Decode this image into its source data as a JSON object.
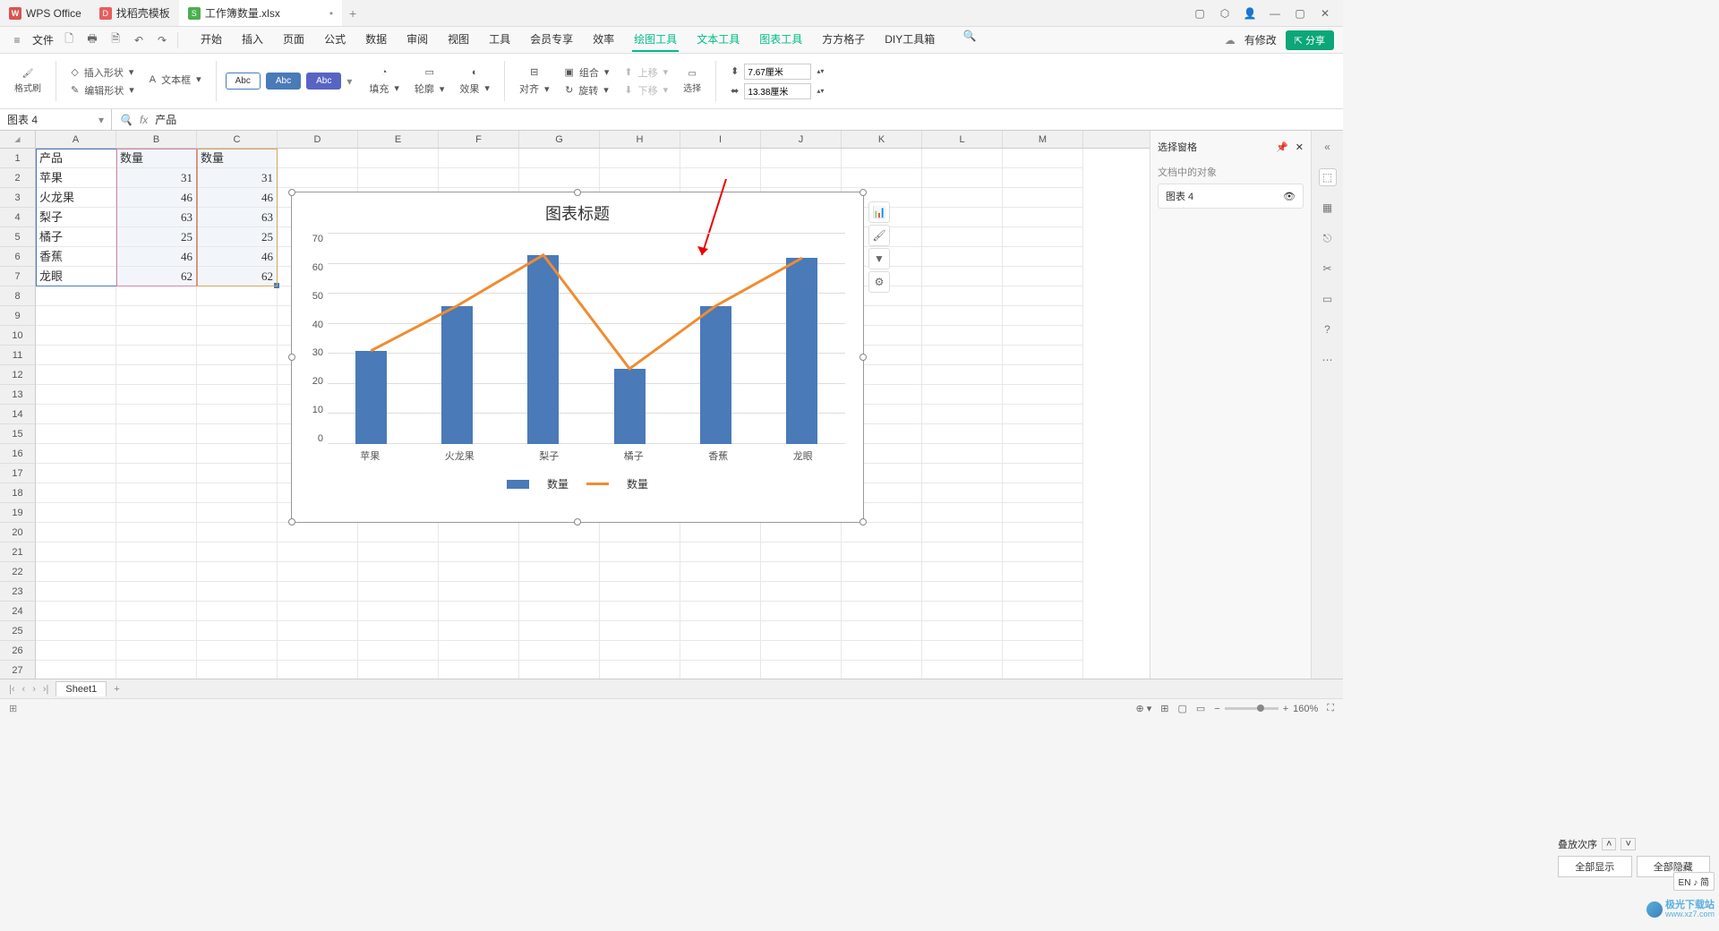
{
  "tabs": {
    "app": "WPS Office",
    "template": "找稻壳模板",
    "file": "工作簿数量.xlsx"
  },
  "menubar": {
    "file": "文件",
    "items": [
      "开始",
      "插入",
      "页面",
      "公式",
      "数据",
      "审阅",
      "视图",
      "工具",
      "会员专享",
      "效率",
      "绘图工具",
      "文本工具",
      "图表工具",
      "方方格子",
      "DIY工具箱"
    ],
    "active": "绘图工具",
    "modify": "有修改",
    "share": "分享"
  },
  "ribbon": {
    "format_brush": "格式刷",
    "insert_shape": "插入形状",
    "text_box": "文本框",
    "edit_shape": "编辑形状",
    "abc": "Abc",
    "fill": "填充",
    "outline": "轮廓",
    "effect": "效果",
    "align": "对齐",
    "group": "组合",
    "rotate": "旋转",
    "up": "上移",
    "down": "下移",
    "select": "选择",
    "width": "7.67厘米",
    "height": "13.38厘米"
  },
  "formula_bar": {
    "name_box": "图表 4",
    "content": "产品"
  },
  "columns": [
    "A",
    "B",
    "C",
    "D",
    "E",
    "F",
    "G",
    "H",
    "I",
    "J",
    "K",
    "L",
    "M"
  ],
  "table": {
    "headers": [
      "产品",
      "数量",
      "数量"
    ],
    "rows": [
      [
        "苹果",
        "31",
        "31"
      ],
      [
        "火龙果",
        "46",
        "46"
      ],
      [
        "梨子",
        "63",
        "63"
      ],
      [
        "橘子",
        "25",
        "25"
      ],
      [
        "香蕉",
        "46",
        "46"
      ],
      [
        "龙眼",
        "62",
        "62"
      ]
    ]
  },
  "chart_data": {
    "type": "bar+line",
    "title": "图表标题",
    "categories": [
      "苹果",
      "火龙果",
      "梨子",
      "橘子",
      "香蕉",
      "龙眼"
    ],
    "series": [
      {
        "name": "数量",
        "type": "bar",
        "values": [
          31,
          46,
          63,
          25,
          46,
          62
        ]
      },
      {
        "name": "数量",
        "type": "line",
        "values": [
          31,
          46,
          63,
          25,
          46,
          62
        ]
      }
    ],
    "ylim": [
      0,
      70
    ],
    "yticks": [
      0,
      10,
      20,
      30,
      40,
      50,
      60,
      70
    ]
  },
  "right_panel": {
    "title": "选择窗格",
    "subtitle": "文档中的对象",
    "item": "图表 4",
    "layer_order": "叠放次序",
    "show_all": "全部显示",
    "hide_all": "全部隐藏"
  },
  "sheet_tab": "Sheet1",
  "status": {
    "zoom": "160%",
    "ime": "EN ♪ 简"
  },
  "watermark": {
    "name": "极光下载站",
    "url": "www.xz7.com"
  }
}
